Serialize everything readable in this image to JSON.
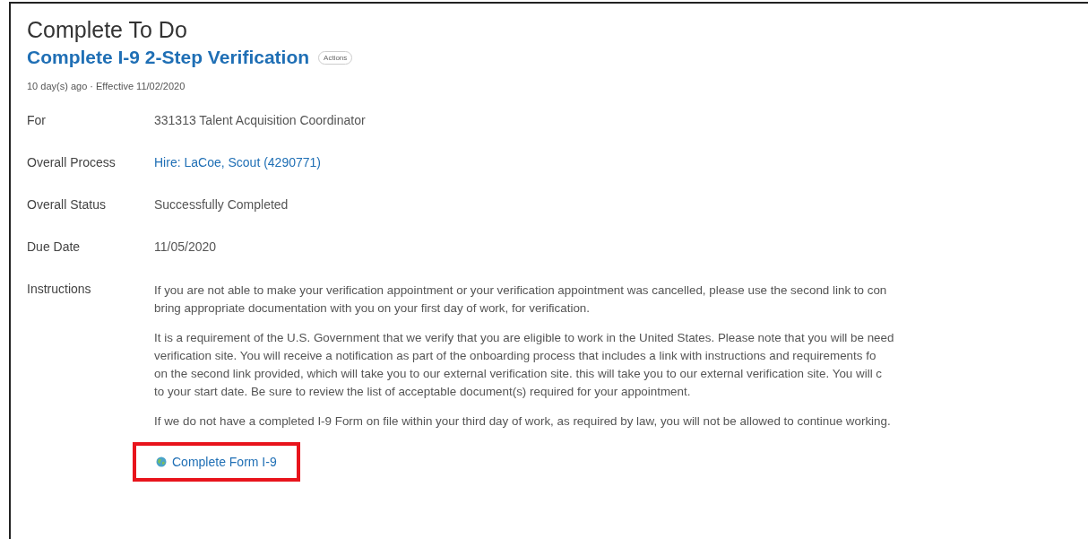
{
  "page": {
    "title": "Complete To Do"
  },
  "task": {
    "title": "Complete I-9 2-Step Verification",
    "actions_button": "Actions",
    "meta": "10 day(s) ago · Effective 11/02/2020"
  },
  "fields": [
    {
      "label": "For",
      "value": "331313 Talent Acquisition Coordinator",
      "kind": "text"
    },
    {
      "label": "Overall Process",
      "value": "Hire: LaCoe, Scout (4290771)",
      "kind": "link"
    },
    {
      "label": "Overall Status",
      "value": "Successfully Completed",
      "kind": "text"
    },
    {
      "label": "Due Date",
      "value": "11/05/2020",
      "kind": "text"
    }
  ],
  "instructions": {
    "label": "Instructions",
    "paragraphs": [
      [
        "If you are not able to make your verification appointment or your verification appointment was cancelled, please use the second link to con",
        "bring appropriate documentation with you on your first day of work, for verification."
      ],
      [
        "It is a requirement of the U.S. Government that we verify that you are eligible to work in the United States.  Please note that you will be need",
        "verification site.  You will receive a notification as part of the onboarding process that includes a link with instructions and requirements fo",
        "on the second link provided, which will take you to our external verification site. this will take you to our external verification site.  You will c",
        "to your start date.  Be sure to review the list of acceptable document(s) required for your appointment."
      ],
      [
        "If we do not have a completed I-9 Form on file within your third day of work, as required by law, you will not be allowed to continue working."
      ]
    ],
    "link": {
      "label": "Complete Form I-9",
      "highlighted": true
    }
  }
}
